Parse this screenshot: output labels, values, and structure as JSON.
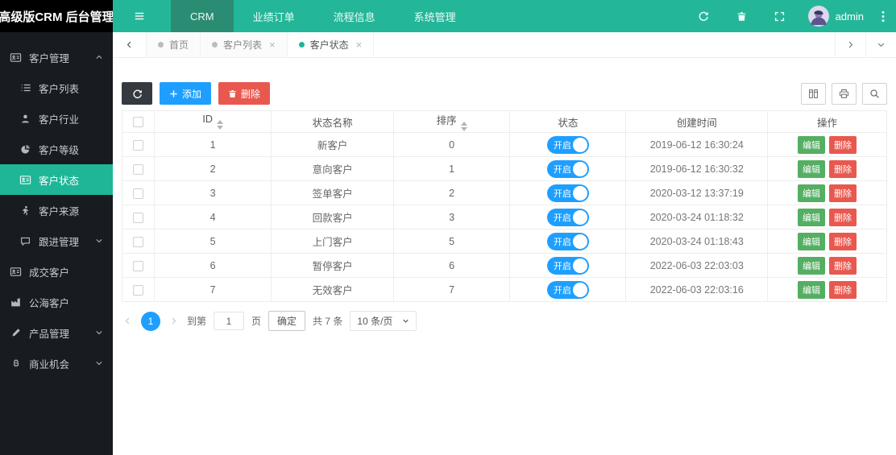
{
  "app": {
    "logo": "高级版CRM 后台管理"
  },
  "topnav": {
    "items": [
      {
        "label": "CRM",
        "active": true
      },
      {
        "label": "业绩订单",
        "active": false
      },
      {
        "label": "流程信息",
        "active": false
      },
      {
        "label": "系统管理",
        "active": false
      }
    ],
    "user": "admin"
  },
  "tabs": {
    "items": [
      {
        "label": "首页",
        "closable": false,
        "active": false
      },
      {
        "label": "客户列表",
        "closable": true,
        "active": false
      },
      {
        "label": "客户状态",
        "closable": true,
        "active": true
      }
    ]
  },
  "sidebar": {
    "items": [
      {
        "label": "客户管理",
        "icon": "idcard-icon",
        "level": "top",
        "expanded": true
      },
      {
        "label": "客户列表",
        "icon": "list-icon",
        "level": "sub"
      },
      {
        "label": "客户行业",
        "icon": "user-icon",
        "level": "sub"
      },
      {
        "label": "客户等级",
        "icon": "pie-chart-icon",
        "level": "sub"
      },
      {
        "label": "客户状态",
        "icon": "idcard-icon",
        "level": "sub",
        "active": true
      },
      {
        "label": "客户来源",
        "icon": "walking-icon",
        "level": "sub"
      },
      {
        "label": "跟进管理",
        "icon": "comment-icon",
        "level": "sub",
        "collapsed": true
      },
      {
        "label": "成交客户",
        "icon": "idcard-icon",
        "level": "top"
      },
      {
        "label": "公海客户",
        "icon": "industry-icon",
        "level": "top"
      },
      {
        "label": "产品管理",
        "icon": "pencil-icon",
        "level": "top",
        "collapsed": true
      },
      {
        "label": "商业机会",
        "icon": "bitcoin-icon",
        "level": "top",
        "collapsed": true
      }
    ]
  },
  "toolbar": {
    "add_label": "添加",
    "delete_label": "删除"
  },
  "table": {
    "headers": {
      "id": "ID",
      "name": "状态名称",
      "sort": "排序",
      "status": "状态",
      "created": "创建时间",
      "ops": "操作"
    },
    "actions": {
      "edit": "编辑",
      "delete": "删除"
    },
    "rows": [
      {
        "id": "1",
        "name": "新客户",
        "sort": "0",
        "status_label": "开启",
        "created": "2019-06-12 16:30:24"
      },
      {
        "id": "2",
        "name": "意向客户",
        "sort": "1",
        "status_label": "开启",
        "created": "2019-06-12 16:30:32"
      },
      {
        "id": "3",
        "name": "签单客户",
        "sort": "2",
        "status_label": "开启",
        "created": "2020-03-12 13:37:19"
      },
      {
        "id": "4",
        "name": "回款客户",
        "sort": "3",
        "status_label": "开启",
        "created": "2020-03-24 01:18:32"
      },
      {
        "id": "5",
        "name": "上门客户",
        "sort": "5",
        "status_label": "开启",
        "created": "2020-03-24 01:18:43"
      },
      {
        "id": "6",
        "name": "暂停客户",
        "sort": "6",
        "status_label": "开启",
        "created": "2022-06-03 22:03:03"
      },
      {
        "id": "7",
        "name": "无效客户",
        "sort": "7",
        "status_label": "开启",
        "created": "2022-06-03 22:03:16"
      }
    ]
  },
  "pagination": {
    "current_page": "1",
    "goto_prefix": "到第",
    "goto_value": "1",
    "goto_suffix": "页",
    "confirm_label": "确定",
    "total_label": "共 7 条",
    "page_size_label": "10 条/页"
  },
  "ui": {
    "close_glyph": "×"
  },
  "icons": {
    "hamburger-icon": "☰",
    "refresh-icon": "⟳",
    "clear-icon": "🗑",
    "fullscreen-icon": "⛶",
    "kebab-icon": "⋮",
    "idcard-icon": "▤",
    "list-icon": "≡",
    "user-icon": "👤",
    "pie-chart-icon": "◔",
    "walking-icon": "🚶",
    "comment-icon": "💬",
    "industry-icon": "🏭",
    "pencil-icon": "✎",
    "bitcoin-icon": "₿",
    "plus-icon": "+",
    "trash-icon": "🗑",
    "columns-icon": "▥",
    "print-icon": "⎙",
    "search-icon": "🔍",
    "chevron-up-icon": "∧",
    "chevron-down-icon": "∨",
    "chevron-left-icon": "<",
    "chevron-right-icon": ">"
  },
  "colors": {
    "navbar": "#24b698",
    "navbar_active": "#2b8c74",
    "sidebar": "#181b20",
    "sidebar_active": "#1fb698",
    "primary_blue": "#1E9FFF",
    "danger_red": "#e8584f",
    "success_green": "#54af62",
    "dark_button": "#343a40"
  }
}
